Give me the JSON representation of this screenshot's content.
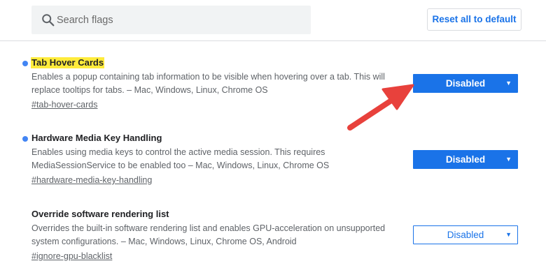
{
  "search": {
    "placeholder": "Search flags",
    "value": ""
  },
  "reset_label": "Reset all to default",
  "flags": [
    {
      "title": "Tab Hover Cards",
      "highlighted": true,
      "modified": true,
      "desc_line1": "Enables a popup containing tab information to be visible when hovering over a tab. This will",
      "desc_line2": "replace tooltips for tabs. – Mac, Windows, Linux, Chrome OS",
      "link": "#tab-hover-cards",
      "select_value": "Disabled"
    },
    {
      "title": "Hardware Media Key Handling",
      "highlighted": false,
      "modified": true,
      "desc_line1": "Enables using media keys to control the active media session. This requires",
      "desc_line2": "MediaSessionService to be enabled too – Mac, Windows, Linux, Chrome OS",
      "link": "#hardware-media-key-handling",
      "select_value": "Disabled"
    },
    {
      "title": "Override software rendering list",
      "highlighted": false,
      "modified": false,
      "desc_line1": "Overrides the built-in software rendering list and enables GPU-acceleration on unsupported",
      "desc_line2": "system configurations. – Mac, Windows, Linux, Chrome OS, Android",
      "link": "#ignore-gpu-blacklist",
      "select_value": "Disabled"
    }
  ],
  "colors": {
    "accent": "#1a73e8",
    "modified_dot": "#4285f4",
    "highlight": "#ffeb3b",
    "annotation_arrow": "#e8413c"
  },
  "icons": {
    "search": "search-icon",
    "caret": "chevron-down-icon",
    "annotation": "red-arrow-annotation"
  }
}
